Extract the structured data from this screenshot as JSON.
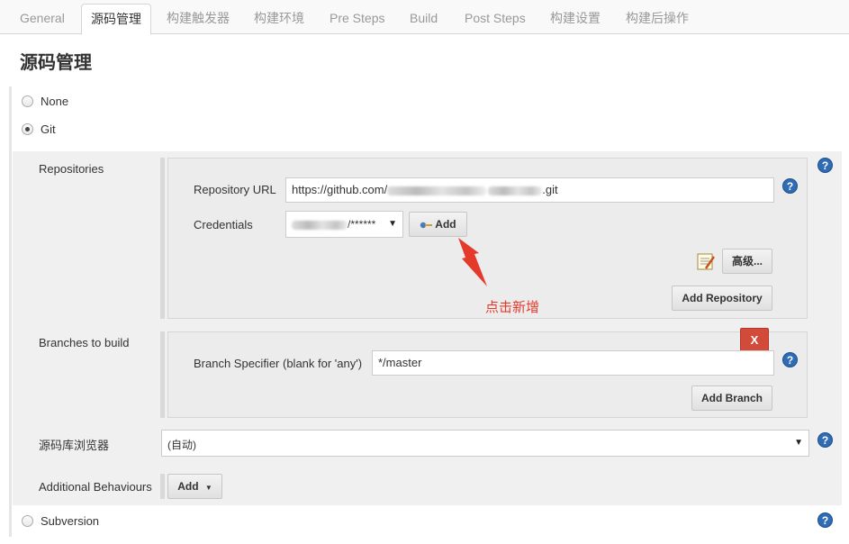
{
  "tabs": [
    {
      "label": "General",
      "active": false
    },
    {
      "label": "源码管理",
      "active": true
    },
    {
      "label": "构建触发器",
      "active": false
    },
    {
      "label": "构建环境",
      "active": false
    },
    {
      "label": "Pre Steps",
      "active": false
    },
    {
      "label": "Build",
      "active": false
    },
    {
      "label": "Post Steps",
      "active": false
    },
    {
      "label": "构建设置",
      "active": false
    },
    {
      "label": "构建后操作",
      "active": false
    }
  ],
  "section_title": "源码管理",
  "scm_options": {
    "none": "None",
    "git": "Git",
    "subversion": "Subversion",
    "selected": "Git"
  },
  "repositories": {
    "label": "Repositories",
    "repo_url_label": "Repository URL",
    "repo_url_prefix": "https://github.com/",
    "repo_url_suffix": ".git",
    "credentials_label": "Credentials",
    "credentials_value_suffix": "/******",
    "add_credentials_button": "Add",
    "advanced_button": "高级...",
    "add_repository_button": "Add Repository"
  },
  "annotation": "点击新增",
  "branches": {
    "label": "Branches to build",
    "delete_button": "X",
    "specifier_label": "Branch Specifier (blank for 'any')",
    "specifier_value": "*/master",
    "add_branch_button": "Add Branch"
  },
  "repo_browser": {
    "label": "源码库浏览器",
    "value": "(自动)"
  },
  "additional_behaviours": {
    "label": "Additional Behaviours",
    "add_button": "Add"
  },
  "colors": {
    "annotation_red": "#e43a2b",
    "delete_red": "#d24a3a",
    "help_blue": "#2f6cb5"
  },
  "icons": {
    "help": "help-icon",
    "key": "key-icon",
    "notepad": "notepad-icon",
    "arrow": "red-arrow-icon"
  }
}
